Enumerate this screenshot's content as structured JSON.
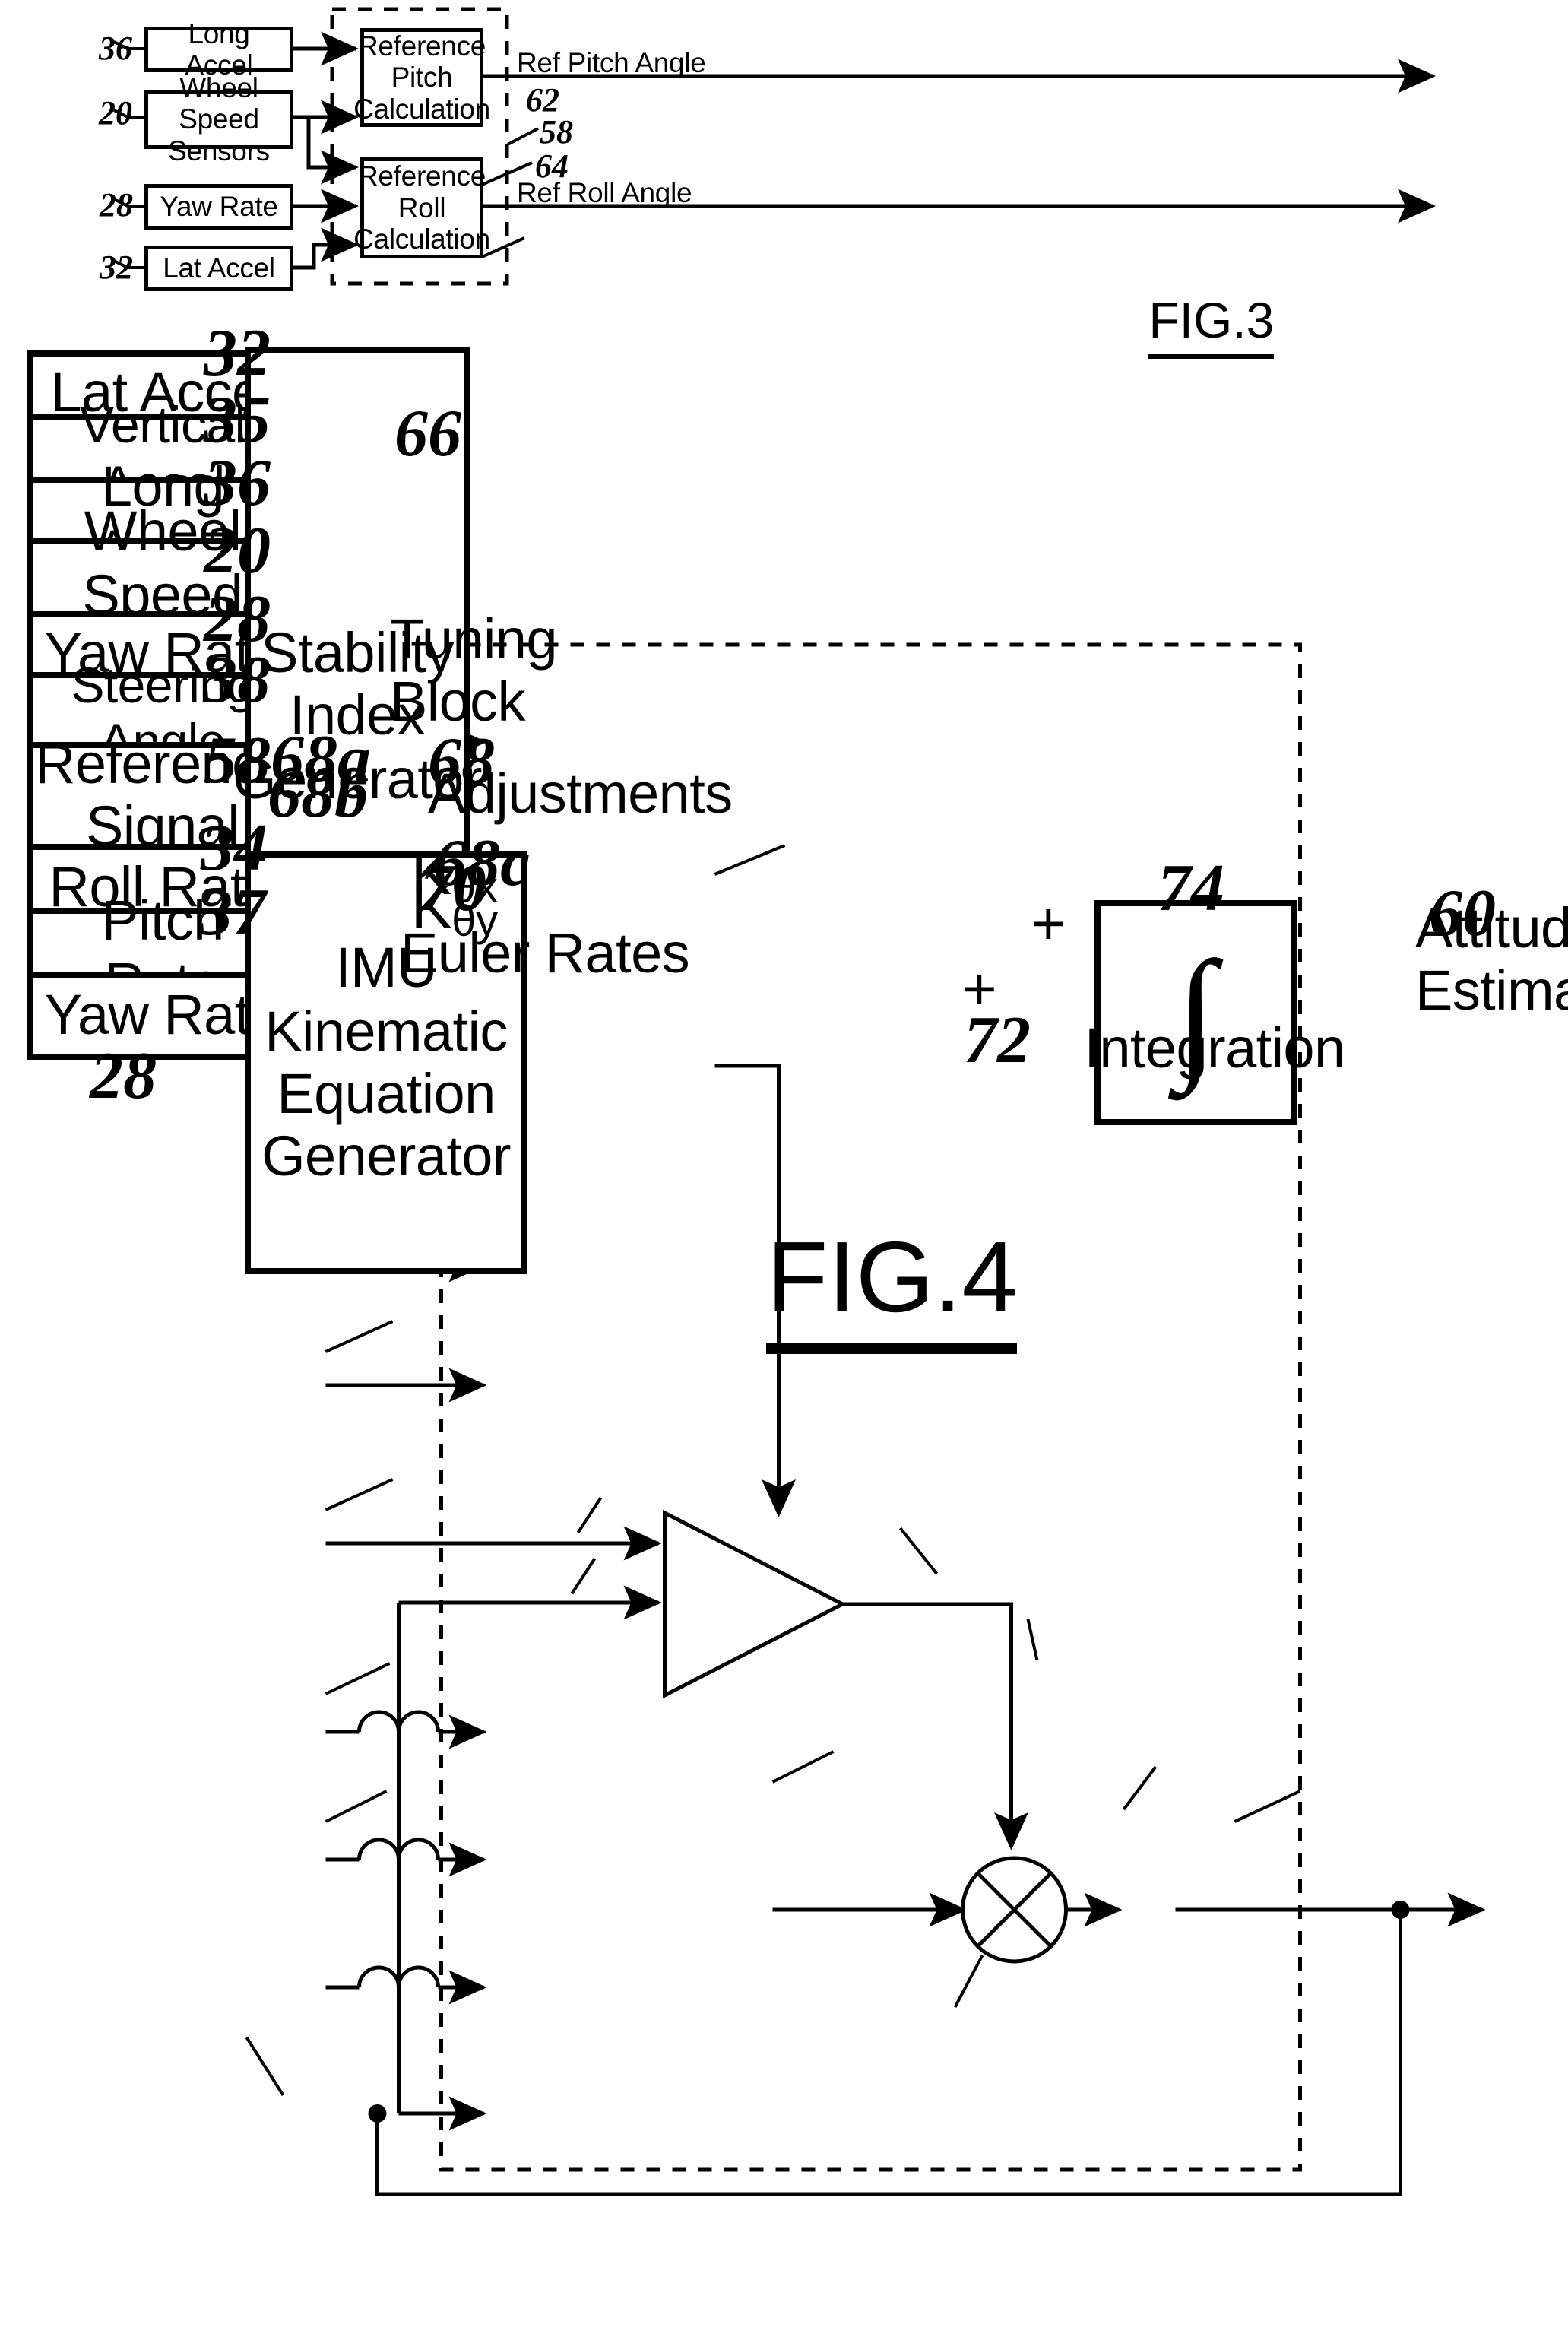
{
  "figures": [
    {
      "caption": "FIG.3",
      "inputs": [
        {
          "ref": "36",
          "label": "Long Accel"
        },
        {
          "ref": "20",
          "label": "Wheel Speed\nSensors"
        },
        {
          "ref": "28",
          "label": "Yaw Rate"
        },
        {
          "ref": "32",
          "label": "Lat Accel"
        }
      ],
      "processes": [
        {
          "ref": "62",
          "label": "Reference\nPitch\nCalculation"
        },
        {
          "ref": "64",
          "label": "Reference\nRoll\nCalculation"
        }
      ],
      "outputs": [
        {
          "label": "Ref Pitch Angle"
        },
        {
          "label": "Ref Roll Angle"
        }
      ],
      "enclosure_ref": "58"
    },
    {
      "caption": "FIG.4",
      "enclosure_ref": "60",
      "inputs": [
        {
          "ref": "32",
          "label": "Lat  Accel"
        },
        {
          "ref": "35",
          "label": "Vertical Accel"
        },
        {
          "ref": "36",
          "label": "Long Accel"
        },
        {
          "ref": "20",
          "label": "Wheel Speed\nSensors"
        },
        {
          "ref": "28",
          "label": "Yaw Rate"
        },
        {
          "ref": "38",
          "label": "Steering Angle"
        },
        {
          "ref": "58",
          "label": "Reference\nSignal\nGenerator"
        },
        {
          "ref": "34",
          "label": "Roll Rate"
        },
        {
          "ref": "37",
          "label": "Pitch Rate"
        },
        {
          "ref": "28",
          "label": "Yaw Rate"
        }
      ],
      "blocks": [
        {
          "ref": "66",
          "label": "Stability\nIndex\nGenerator"
        },
        {
          "ref": "70",
          "label": "IMU\nKinematic\nEquation\nGenerator"
        },
        {
          "ref": "74",
          "label": "Integration",
          "symbol": "∫"
        }
      ],
      "gain": {
        "ref": "68",
        "input_refs": [
          "68a",
          "68b"
        ],
        "output_ref": "68c",
        "gain_x": "Kθx",
        "gain_y": "Kθy"
      },
      "summing_junction": {
        "ref": "72",
        "sign_top": "+",
        "sign_left": "+"
      },
      "signal_labels": [
        {
          "label": "Tuning\nBlock"
        },
        {
          "label": "Adjustments"
        },
        {
          "label": "Euler Rates"
        },
        {
          "label": "Attitude\nEstimates"
        }
      ]
    }
  ],
  "fig3": {
    "caption": "FIG.3",
    "enclosure_ref": "58",
    "box_long_accel": "Long Accel",
    "box_wheel_speed": "Wheel Speed\nSensors",
    "box_yaw_rate": "Yaw Rate",
    "box_lat_accel": "Lat Accel",
    "box_ref_pitch": "Reference\nPitch\nCalculation",
    "box_ref_roll": "Reference\nRoll\nCalculation",
    "out_pitch": "Ref Pitch Angle",
    "out_roll": "Ref Roll Angle",
    "ref_long_accel": "36",
    "ref_wheel_speed": "20",
    "ref_yaw_rate": "28",
    "ref_lat_accel": "32",
    "ref_pitch_calc": "62",
    "ref_roll_calc": "64",
    "ref_enclosure": "58"
  },
  "fig4": {
    "caption": "FIG.4",
    "box_lat_accel": "Lat  Accel",
    "box_vertical_accel": "Vertical Accel",
    "box_long_accel": "Long Accel",
    "box_wheel_speed": "Wheel Speed\nSensors",
    "box_yaw_rate_top": "Yaw Rate",
    "box_steering_angle": "Steering Angle",
    "box_ref_sig_gen": "Reference\nSignal\nGenerator",
    "box_roll_rate": "Roll Rate",
    "box_pitch_rate": "Pitch Rate",
    "box_yaw_rate_bot": "Yaw Rate",
    "box_stability_index": "Stability\nIndex\nGenerator",
    "box_imu_kinematic": "IMU\nKinematic\nEquation\nGenerator",
    "integration_symbol": "∫",
    "integration_label": "Integration",
    "gain_kx": "K",
    "gain_kx_sub": "θx",
    "gain_ky": "K",
    "gain_ky_sub": "θy",
    "lbl_tuning_block": "Tuning\nBlock",
    "lbl_adjustments": "Adjustments",
    "lbl_euler_rates": "Euler Rates",
    "lbl_attitude_estimates": "Attitude\nEstimates",
    "plus_top": "+",
    "plus_left": "+",
    "ref_lat_accel": "32",
    "ref_vertical_accel": "35",
    "ref_long_accel": "36",
    "ref_wheel_speed": "20",
    "ref_yaw_rate_top": "28",
    "ref_steering_angle": "38",
    "ref_ref_sig_gen": "58",
    "ref_roll_rate": "34",
    "ref_pitch_rate": "37",
    "ref_yaw_rate_bot": "28",
    "ref_stability_index": "66",
    "ref_enclosure": "60",
    "ref_gain": "68",
    "ref_gain_in_a": "68a",
    "ref_gain_in_b": "68b",
    "ref_gain_out_c": "68c",
    "ref_imu": "70",
    "ref_sum": "72",
    "ref_integration": "74"
  }
}
